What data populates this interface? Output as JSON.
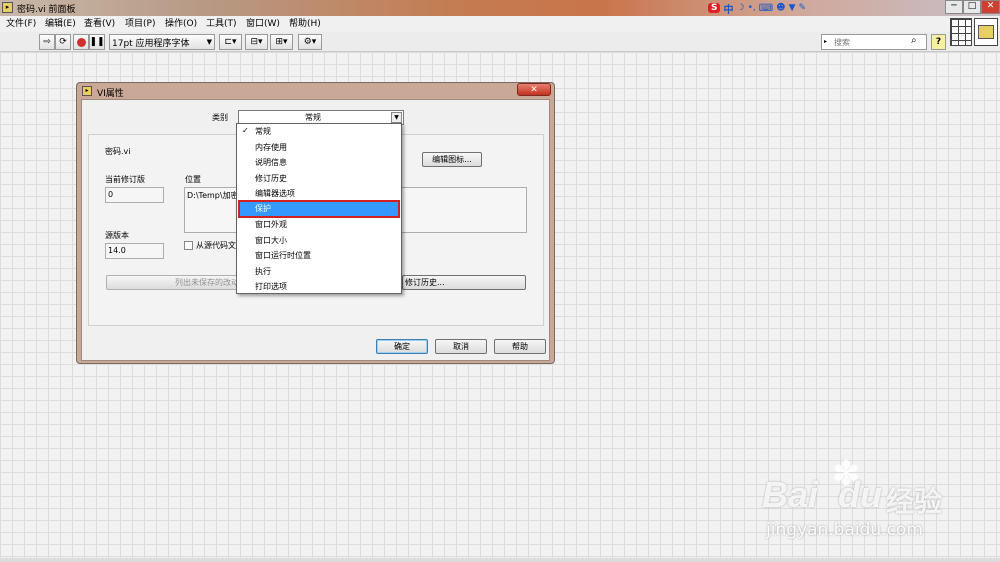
{
  "window": {
    "title": "密码.vi 前面板",
    "controls": [
      "─",
      "□",
      "✕"
    ]
  },
  "menu": [
    "文件(F)",
    "编辑(E)",
    "查看(V)",
    "项目(P)",
    "操作(O)",
    "工具(T)",
    "窗口(W)",
    "帮助(H)"
  ],
  "ime": {
    "logo": "S",
    "mode": "中"
  },
  "toolbar": {
    "font": "17pt 应用程序字体",
    "search_placeholder": "搜索",
    "help": "?"
  },
  "dialog": {
    "title": "VI属性",
    "category_label": "类别",
    "category_value": "常规",
    "file_name": "密码.vi",
    "edit_icon_btn": "编辑图标...",
    "current_revision_label": "当前修订版",
    "current_revision_value": "0",
    "location_label": "位置",
    "location_value": "D:\\Temp\\加密",
    "source_version_label": "源版本",
    "source_version_value": "14.0",
    "separate_source_label": "从源代码文",
    "list_unsaved_btn": "列出未保存的改动",
    "revision_history_btn": "修订历史...",
    "ok": "确定",
    "cancel": "取消",
    "help": "帮助"
  },
  "dropdown": {
    "checkmark": "✓",
    "items": [
      "常规",
      "内存使用",
      "说明信息",
      "修订历史",
      "编辑器选项",
      "保护",
      "窗口外观",
      "窗口大小",
      "窗口运行时位置",
      "执行",
      "打印选项"
    ],
    "selected": "保护"
  },
  "watermark": {
    "brand": "Bai",
    "brand2": "du",
    "cn": "经验",
    "url": "jingyan.baidu.com"
  },
  "colors": {
    "selection": "#3399ff",
    "highlight_border": "#d02020"
  }
}
